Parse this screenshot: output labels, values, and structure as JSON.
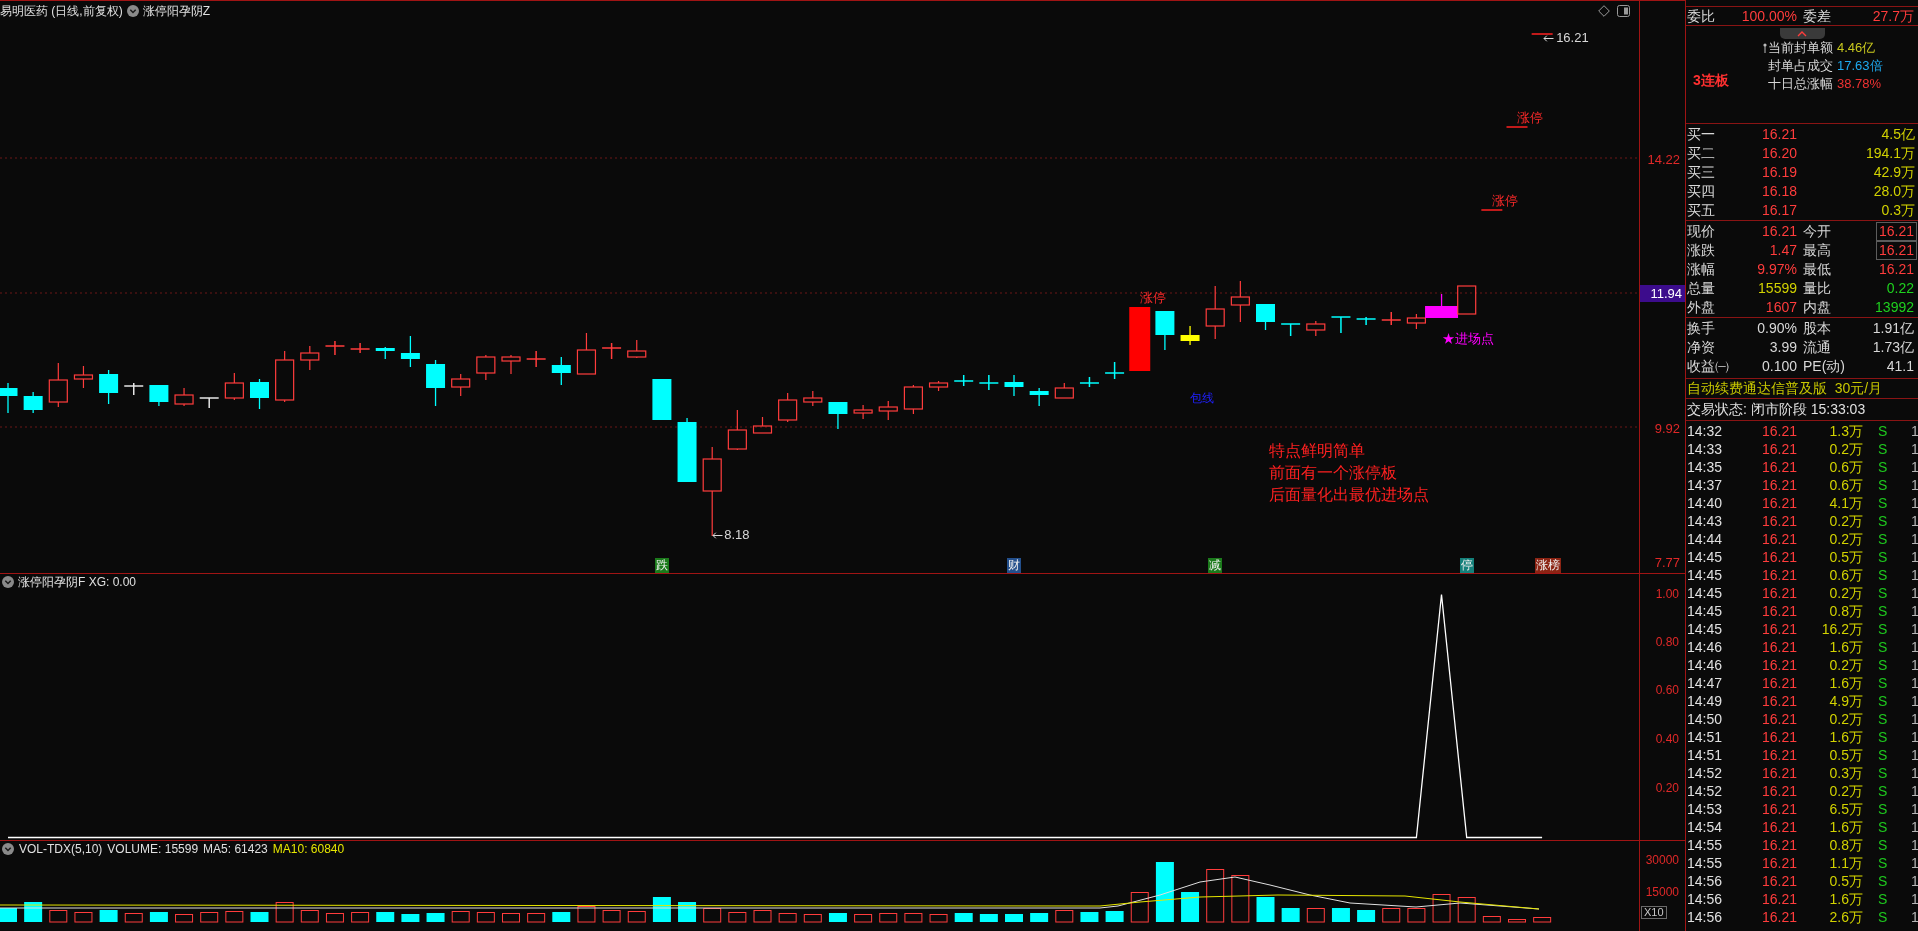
{
  "header": {
    "title": "易明医药 (日线,前复权)",
    "formula": "涨停阳孕阴Z"
  },
  "price_chart": {
    "axis_labels": [
      {
        "text": "14.22",
        "highlighted": false
      },
      {
        "text": "11.94",
        "highlighted": true
      },
      {
        "text": "9.92",
        "highlighted": false
      },
      {
        "text": "7.77",
        "highlighted": false
      }
    ],
    "high_label": "16.21",
    "low_label": "8.18",
    "limit_up_labels": [
      "涨停",
      "涨停",
      "涨停"
    ],
    "pattern_label": "包线",
    "entry_label": "★进场点",
    "note_lines": [
      "特点鲜明简单",
      "前面有一个涨停板",
      "后面量化出最优进场点"
    ],
    "event_tags": [
      {
        "text": "跌",
        "color": "#1b7a1b"
      },
      {
        "text": "财",
        "color": "#234f8c"
      },
      {
        "text": "减",
        "color": "#1b7a1b"
      },
      {
        "text": "停",
        "color": "#14807a"
      },
      {
        "text": "涨榜",
        "color": "#8c2414"
      }
    ]
  },
  "indicator_panel": {
    "title": "涨停阳孕阴F XG: 0.00",
    "axis_labels": [
      "1.00",
      "0.80",
      "0.60",
      "0.40",
      "0.20"
    ]
  },
  "volume_panel": {
    "legend": [
      {
        "text": "VOL-TDX(5,10)",
        "color": "#e0e0e0"
      },
      {
        "text": "VOLUME: 15599",
        "color": "#e0e0e0"
      },
      {
        "text": "MA5: 61423",
        "color": "#e0e0e0"
      },
      {
        "text": "MA10: 60840",
        "color": "#e6e600"
      }
    ],
    "axis_labels": [
      "30000",
      "15000"
    ],
    "scale_label": "X10"
  },
  "quote": {
    "order_ratio": [
      {
        "label": "委比",
        "value": "100.00%"
      },
      {
        "label": "委差",
        "value": "27.7万"
      }
    ],
    "seal": {
      "badge": "3连板",
      "rows": [
        {
          "label": "当前封单额",
          "value": "4.46亿",
          "color": "#c8c81e"
        },
        {
          "label": "封单占成交",
          "value": "17.63倍",
          "color": "#1eaaf0"
        },
        {
          "label": "十日总涨幅",
          "value": "38.78%",
          "color": "#f03232"
        }
      ]
    },
    "bids": [
      {
        "label": "买一",
        "price": "16.21",
        "volume": "4.5亿"
      },
      {
        "label": "买二",
        "price": "16.20",
        "volume": "194.1万"
      },
      {
        "label": "买三",
        "price": "16.19",
        "volume": "42.9万"
      },
      {
        "label": "买四",
        "price": "16.18",
        "volume": "28.0万"
      },
      {
        "label": "买五",
        "price": "16.17",
        "volume": "0.3万"
      }
    ],
    "stats": [
      {
        "left": {
          "label": "现价",
          "value": "16.21",
          "color": "#ff3c3c"
        },
        "right": {
          "label": "今开",
          "value": "16.21",
          "color": "#ff3c3c",
          "framed": true
        }
      },
      {
        "left": {
          "label": "涨跌",
          "value": "1.47",
          "color": "#ff3c3c"
        },
        "right": {
          "label": "最高",
          "value": "16.21",
          "color": "#ff3c3c",
          "framed": true
        }
      },
      {
        "left": {
          "label": "涨幅",
          "value": "9.97%",
          "color": "#ff3c3c"
        },
        "right": {
          "label": "最低",
          "value": "16.21",
          "color": "#ff3c3c",
          "framed": false
        }
      },
      {
        "left": {
          "label": "总量",
          "value": "15599",
          "color": "#d2d200"
        },
        "right": {
          "label": "量比",
          "value": "0.22",
          "color": "#1ed21e",
          "framed": false
        }
      },
      {
        "left": {
          "label": "外盘",
          "value": "1607",
          "color": "#ff3c3c"
        },
        "right": {
          "label": "内盘",
          "value": "13992",
          "color": "#1ed21e",
          "framed": false
        }
      }
    ],
    "fundamentals": [
      {
        "left": {
          "label": "换手",
          "value": "0.90%"
        },
        "right": {
          "label": "股本",
          "value": "1.91亿"
        }
      },
      {
        "left": {
          "label": "净资",
          "value": "3.99"
        },
        "right": {
          "label": "流通",
          "value": "1.73亿"
        }
      },
      {
        "left": {
          "label": "收益㈠",
          "value": "0.100"
        },
        "right": {
          "label": "PE(动)",
          "value": "41.1"
        }
      }
    ],
    "promo": "自动续费通达信普及版  30元/月",
    "status": "交易状态: 闭市阶段 15:33:03",
    "trades": [
      {
        "time": "14:32",
        "price": "16.21",
        "volume": "1.3万",
        "side": "S",
        "column_5": "1"
      },
      {
        "time": "14:33",
        "price": "16.21",
        "volume": "0.2万",
        "side": "S",
        "column_5": "1"
      },
      {
        "time": "14:35",
        "price": "16.21",
        "volume": "0.6万",
        "side": "S",
        "column_5": "1"
      },
      {
        "time": "14:37",
        "price": "16.21",
        "volume": "0.6万",
        "side": "S",
        "column_5": "1"
      },
      {
        "time": "14:40",
        "price": "16.21",
        "volume": "4.1万",
        "side": "S",
        "column_5": "1"
      },
      {
        "time": "14:43",
        "price": "16.21",
        "volume": "0.2万",
        "side": "S",
        "column_5": "1"
      },
      {
        "time": "14:44",
        "price": "16.21",
        "volume": "0.2万",
        "side": "S",
        "column_5": "1"
      },
      {
        "time": "14:45",
        "price": "16.21",
        "volume": "0.5万",
        "side": "S",
        "column_5": "1"
      },
      {
        "time": "14:45",
        "price": "16.21",
        "volume": "0.6万",
        "side": "S",
        "column_5": "1"
      },
      {
        "time": "14:45",
        "price": "16.21",
        "volume": "0.2万",
        "side": "S",
        "column_5": "1"
      },
      {
        "time": "14:45",
        "price": "16.21",
        "volume": "0.8万",
        "side": "S",
        "column_5": "1"
      },
      {
        "time": "14:45",
        "price": "16.21",
        "volume": "16.2万",
        "side": "S",
        "column_5": "1"
      },
      {
        "time": "14:46",
        "price": "16.21",
        "volume": "1.6万",
        "side": "S",
        "column_5": "1"
      },
      {
        "time": "14:46",
        "price": "16.21",
        "volume": "0.2万",
        "side": "S",
        "column_5": "1"
      },
      {
        "time": "14:47",
        "price": "16.21",
        "volume": "1.6万",
        "side": "S",
        "column_5": "1"
      },
      {
        "time": "14:49",
        "price": "16.21",
        "volume": "4.9万",
        "side": "S",
        "column_5": "1"
      },
      {
        "time": "14:50",
        "price": "16.21",
        "volume": "0.2万",
        "side": "S",
        "column_5": "1"
      },
      {
        "time": "14:51",
        "price": "16.21",
        "volume": "1.6万",
        "side": "S",
        "column_5": "1"
      },
      {
        "time": "14:51",
        "price": "16.21",
        "volume": "0.5万",
        "side": "S",
        "column_5": "1"
      },
      {
        "time": "14:52",
        "price": "16.21",
        "volume": "0.3万",
        "side": "S",
        "column_5": "1"
      },
      {
        "time": "14:52",
        "price": "16.21",
        "volume": "0.2万",
        "side": "S",
        "column_5": "1"
      },
      {
        "time": "14:53",
        "price": "16.21",
        "volume": "6.5万",
        "side": "S",
        "column_5": "1"
      },
      {
        "time": "14:54",
        "price": "16.21",
        "volume": "1.6万",
        "side": "S",
        "column_5": "1"
      },
      {
        "time": "14:55",
        "price": "16.21",
        "volume": "0.8万",
        "side": "S",
        "column_5": "1"
      },
      {
        "time": "14:55",
        "price": "16.21",
        "volume": "1.1万",
        "side": "S",
        "column_5": "1"
      },
      {
        "time": "14:56",
        "price": "16.21",
        "volume": "0.5万",
        "side": "S",
        "column_5": "1"
      },
      {
        "time": "14:56",
        "price": "16.21",
        "volume": "1.6万",
        "side": "S",
        "column_5": "1"
      },
      {
        "time": "14:56",
        "price": "16.21",
        "volume": "2.6万",
        "side": "S",
        "column_5": "1"
      }
    ]
  }
}
